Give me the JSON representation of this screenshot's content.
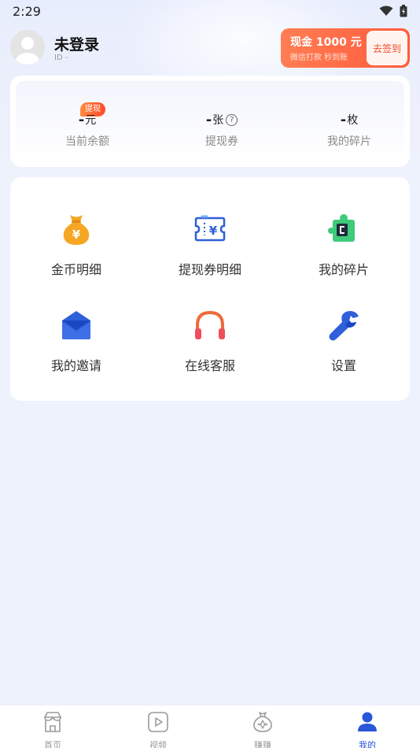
{
  "status_bar": {
    "time": "2:29"
  },
  "profile": {
    "name": "未登录",
    "id_text": "ID  -"
  },
  "promo": {
    "title": "现金 1000 元",
    "subtitle": "微信打款 秒到账",
    "button": "去签到"
  },
  "stats": {
    "badge": "提现",
    "items": [
      {
        "value": "-",
        "unit": "元",
        "label": "当前余额"
      },
      {
        "value": "-",
        "unit": "张",
        "label": "提现券"
      },
      {
        "value": "-",
        "unit": "枚",
        "label": "我的碎片"
      }
    ]
  },
  "grid": {
    "items": [
      {
        "label": "金币明细",
        "icon": "money-bag-icon"
      },
      {
        "label": "提现券明细",
        "icon": "coupon-icon"
      },
      {
        "label": "我的碎片",
        "icon": "puzzle-icon"
      },
      {
        "label": "我的邀请",
        "icon": "envelope-icon"
      },
      {
        "label": "在线客服",
        "icon": "headphones-icon"
      },
      {
        "label": "设置",
        "icon": "wrench-icon"
      }
    ]
  },
  "nav": {
    "items": [
      {
        "label": "首页",
        "icon": "home-icon"
      },
      {
        "label": "视频",
        "icon": "video-icon"
      },
      {
        "label": "赚赚",
        "icon": "earn-icon"
      },
      {
        "label": "我的",
        "icon": "profile-icon"
      }
    ],
    "active_index": 3
  },
  "colors": {
    "accent": "#2a56d8",
    "promo": "#ff5a3c",
    "background": "#eef2fd"
  }
}
